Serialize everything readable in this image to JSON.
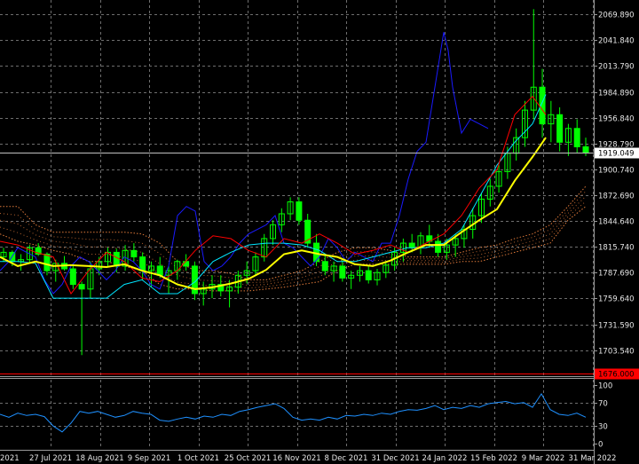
{
  "chart_data": {
    "type": "candlestick",
    "grid": true,
    "colors": {
      "background": "#000000",
      "grid": "#6e6e6e",
      "axis_text": "#e6e6e6",
      "candle": "#00ff00",
      "ma_long": "#ffff00",
      "tenkan": "#ff0000",
      "kijun": "#00e5ff",
      "chikou": "#1a1aff",
      "cloud": "#e07a3a",
      "rsi": "#1e90ff",
      "current_price_line": "#c0c0c0",
      "alert_line": "#ff0000",
      "alert_tag_bg": "#ff0000",
      "current_tag_bg": "#ffffff"
    },
    "price_axis": {
      "ylim": [
        1676.0,
        2085.0
      ],
      "ticks": [
        "2069.890",
        "2041.840",
        "2013.790",
        "1984.890",
        "1956.840",
        "1928.790",
        "1900.740",
        "1872.690",
        "1844.640",
        "1815.740",
        "1787.690",
        "1759.640",
        "1731.590",
        "1703.540"
      ]
    },
    "current_price": "1919.049",
    "alert_level": "1676.000",
    "date_axis": {
      "labels": [
        "2021",
        "27 Jul 2021",
        "18 Aug 2021",
        "9 Sep 2021",
        "1 Oct 2021",
        "25 Oct 2021",
        "16 Nov 2021",
        "8 Dec 2021",
        "31 Dec 2021",
        "24 Jan 2022",
        "15 Feb 2022",
        "9 Mar 2022",
        "31 Mar 2022"
      ]
    },
    "rsi_axis": {
      "ylim": [
        0,
        100
      ],
      "ticks": [
        "100",
        "70",
        "30",
        "0"
      ]
    },
    "series": [
      {
        "key": "ma_long",
        "x": [
          0,
          20,
          40,
          60,
          80,
          100,
          120,
          140,
          160,
          180,
          200,
          220,
          240,
          260,
          280,
          300,
          320,
          340,
          360,
          380,
          400,
          420,
          440,
          460,
          480,
          500,
          520,
          540,
          560,
          580,
          600,
          615
        ],
        "values": [
          1805,
          1795,
          1800,
          1795,
          1796,
          1795,
          1794,
          1797,
          1790,
          1785,
          1775,
          1770,
          1772,
          1776,
          1781,
          1791,
          1808,
          1812,
          1808,
          1805,
          1797,
          1795,
          1801,
          1810,
          1818,
          1818,
          1832,
          1845,
          1857,
          1888,
          1914,
          1935
        ]
      },
      {
        "key": "tenkan",
        "x": [
          0,
          20,
          40,
          60,
          80,
          100,
          120,
          140,
          160,
          180,
          200,
          220,
          240,
          260,
          280,
          300,
          320,
          340,
          360,
          380,
          400,
          420,
          440,
          460,
          480,
          500,
          520,
          540,
          560,
          580,
          600,
          615
        ],
        "values": [
          1822,
          1818,
          1810,
          1805,
          1765,
          1790,
          1810,
          1800,
          1782,
          1778,
          1790,
          1812,
          1828,
          1825,
          1812,
          1805,
          1825,
          1820,
          1830,
          1820,
          1808,
          1812,
          1818,
          1810,
          1820,
          1830,
          1850,
          1880,
          1900,
          1960,
          1980,
          1960
        ]
      },
      {
        "key": "kijun",
        "x": [
          0,
          20,
          40,
          60,
          80,
          100,
          120,
          140,
          160,
          180,
          200,
          220,
          240,
          260,
          280,
          300,
          320,
          340,
          360,
          380,
          400,
          420,
          440,
          460,
          480,
          500,
          520,
          540,
          560,
          580,
          600,
          615
        ],
        "values": [
          1800,
          1800,
          1798,
          1760,
          1760,
          1760,
          1760,
          1775,
          1780,
          1765,
          1765,
          1778,
          1800,
          1810,
          1818,
          1820,
          1820,
          1818,
          1812,
          1800,
          1800,
          1805,
          1810,
          1815,
          1815,
          1820,
          1835,
          1870,
          1905,
          1930,
          1950,
          1982
        ]
      },
      {
        "key": "chikou",
        "x": [
          0,
          10,
          20,
          30,
          40,
          50,
          60,
          70,
          80,
          90,
          100,
          110,
          120,
          130,
          140,
          150,
          160,
          170,
          180,
          190,
          200,
          210,
          220,
          230,
          240,
          250,
          260,
          270,
          280,
          290,
          300,
          310,
          320,
          330,
          340,
          350,
          360,
          370,
          380,
          390,
          400,
          410,
          420,
          430,
          440,
          450,
          460,
          470,
          480,
          490,
          500,
          505,
          510,
          520,
          530,
          540,
          550
        ],
        "values": [
          1790,
          1800,
          1815,
          1810,
          1805,
          1780,
          1765,
          1775,
          1795,
          1805,
          1800,
          1790,
          1780,
          1790,
          1805,
          1800,
          1790,
          1775,
          1770,
          1795,
          1850,
          1860,
          1855,
          1800,
          1790,
          1795,
          1805,
          1820,
          1830,
          1835,
          1840,
          1850,
          1820,
          1815,
          1805,
          1795,
          1805,
          1825,
          1815,
          1800,
          1810,
          1805,
          1800,
          1820,
          1820,
          1850,
          1890,
          1920,
          1930,
          1990,
          2050,
          2030,
          1990,
          1940,
          1955,
          1950,
          1945
        ]
      },
      {
        "key": "cloud_a",
        "x": [
          0,
          20,
          40,
          60,
          80,
          100,
          120,
          140,
          160,
          180,
          200,
          220,
          240,
          260,
          280,
          300,
          320,
          340,
          360,
          380,
          400,
          420,
          440,
          460,
          480,
          500,
          520,
          540,
          560,
          580,
          600,
          620,
          640,
          660
        ],
        "values": [
          1860,
          1860,
          1840,
          1832,
          1832,
          1832,
          1832,
          1832,
          1830,
          1820,
          1800,
          1790,
          1790,
          1787,
          1780,
          1780,
          1785,
          1790,
          1800,
          1810,
          1815,
          1815,
          1812,
          1805,
          1805,
          1805,
          1810,
          1815,
          1818,
          1825,
          1830,
          1840,
          1860,
          1882
        ]
      },
      {
        "key": "cloud_b",
        "x": [
          0,
          20,
          40,
          60,
          80,
          100,
          120,
          140,
          160,
          180,
          200,
          220,
          240,
          260,
          280,
          300,
          320,
          340,
          360,
          380,
          400,
          420,
          440,
          460,
          480,
          500,
          520,
          540,
          560,
          580,
          600,
          620,
          640,
          660
        ],
        "values": [
          1830,
          1822,
          1818,
          1812,
          1808,
          1800,
          1800,
          1795,
          1790,
          1775,
          1770,
          1770,
          1768,
          1768,
          1768,
          1770,
          1772,
          1775,
          1778,
          1790,
          1797,
          1797,
          1797,
          1797,
          1797,
          1797,
          1800,
          1800,
          1805,
          1810,
          1815,
          1820,
          1845,
          1860
        ]
      },
      {
        "key": "rsi",
        "x": [
          0,
          10,
          20,
          30,
          40,
          50,
          60,
          70,
          80,
          90,
          100,
          110,
          120,
          130,
          140,
          150,
          160,
          170,
          180,
          190,
          200,
          210,
          220,
          230,
          240,
          250,
          260,
          270,
          280,
          290,
          300,
          310,
          320,
          330,
          340,
          350,
          360,
          370,
          380,
          390,
          400,
          410,
          420,
          430,
          440,
          450,
          460,
          470,
          480,
          490,
          500,
          510,
          520,
          530,
          540,
          550,
          560,
          570,
          580,
          590,
          600,
          610,
          620,
          630,
          640,
          650,
          660
        ],
        "values": [
          50,
          45,
          52,
          48,
          50,
          46,
          30,
          20,
          35,
          55,
          52,
          55,
          50,
          45,
          48,
          55,
          52,
          50,
          40,
          38,
          42,
          45,
          42,
          47,
          45,
          50,
          48,
          55,
          58,
          62,
          65,
          68,
          60,
          45,
          40,
          42,
          40,
          45,
          42,
          48,
          47,
          50,
          48,
          52,
          50,
          55,
          58,
          57,
          60,
          65,
          58,
          62,
          60,
          65,
          62,
          68,
          70,
          72,
          68,
          70,
          62,
          85,
          58,
          50,
          48,
          52,
          45
        ]
      }
    ],
    "candles": {
      "note": "OHLC in price units, ordered by date",
      "ohlc": [
        [
          1805,
          1815,
          1800,
          1810
        ],
        [
          1810,
          1812,
          1795,
          1800
        ],
        [
          1800,
          1808,
          1790,
          1802
        ],
        [
          1802,
          1818,
          1798,
          1815
        ],
        [
          1815,
          1820,
          1806,
          1808
        ],
        [
          1808,
          1810,
          1785,
          1790
        ],
        [
          1790,
          1802,
          1778,
          1798
        ],
        [
          1798,
          1806,
          1790,
          1792
        ],
        [
          1792,
          1798,
          1770,
          1775
        ],
        [
          1775,
          1778,
          1698,
          1770
        ],
        [
          1770,
          1800,
          1760,
          1792
        ],
        [
          1792,
          1805,
          1785,
          1800
        ],
        [
          1800,
          1815,
          1795,
          1810
        ],
        [
          1810,
          1814,
          1788,
          1795
        ],
        [
          1795,
          1818,
          1790,
          1812
        ],
        [
          1812,
          1820,
          1800,
          1805
        ],
        [
          1805,
          1810,
          1780,
          1790
        ],
        [
          1790,
          1800,
          1772,
          1795
        ],
        [
          1795,
          1805,
          1782,
          1785
        ],
        [
          1785,
          1795,
          1765,
          1790
        ],
        [
          1790,
          1802,
          1780,
          1800
        ],
        [
          1800,
          1808,
          1790,
          1795
        ],
        [
          1795,
          1800,
          1758,
          1765
        ],
        [
          1765,
          1778,
          1752,
          1770
        ],
        [
          1770,
          1785,
          1760,
          1775
        ],
        [
          1775,
          1785,
          1762,
          1768
        ],
        [
          1768,
          1780,
          1750,
          1772
        ],
        [
          1772,
          1790,
          1765,
          1785
        ],
        [
          1785,
          1800,
          1776,
          1790
        ],
        [
          1790,
          1810,
          1785,
          1805
        ],
        [
          1805,
          1830,
          1800,
          1825
        ],
        [
          1825,
          1845,
          1818,
          1840
        ],
        [
          1840,
          1858,
          1832,
          1852
        ],
        [
          1852,
          1870,
          1845,
          1865
        ],
        [
          1865,
          1870,
          1840,
          1845
        ],
        [
          1845,
          1852,
          1815,
          1820
        ],
        [
          1820,
          1830,
          1795,
          1800
        ],
        [
          1800,
          1808,
          1785,
          1790
        ],
        [
          1790,
          1800,
          1778,
          1795
        ],
        [
          1795,
          1802,
          1778,
          1782
        ],
        [
          1782,
          1790,
          1770,
          1785
        ],
        [
          1785,
          1795,
          1778,
          1790
        ],
        [
          1790,
          1796,
          1776,
          1780
        ],
        [
          1780,
          1792,
          1774,
          1788
        ],
        [
          1788,
          1800,
          1782,
          1796
        ],
        [
          1796,
          1815,
          1790,
          1810
        ],
        [
          1810,
          1825,
          1800,
          1820
        ],
        [
          1820,
          1830,
          1810,
          1815
        ],
        [
          1815,
          1832,
          1808,
          1828
        ],
        [
          1828,
          1840,
          1815,
          1822
        ],
        [
          1822,
          1830,
          1805,
          1810
        ],
        [
          1810,
          1825,
          1802,
          1818
        ],
        [
          1818,
          1830,
          1805,
          1825
        ],
        [
          1825,
          1840,
          1815,
          1835
        ],
        [
          1835,
          1858,
          1825,
          1850
        ],
        [
          1850,
          1875,
          1842,
          1868
        ],
        [
          1868,
          1890,
          1860,
          1882
        ],
        [
          1882,
          1905,
          1875,
          1898
        ],
        [
          1898,
          1925,
          1890,
          1918
        ],
        [
          1918,
          1945,
          1910,
          1935
        ],
        [
          1935,
          1975,
          1925,
          1965
        ],
        [
          1965,
          2075,
          1955,
          1990
        ],
        [
          1990,
          2010,
          1935,
          1950
        ],
        [
          1950,
          1975,
          1930,
          1960
        ],
        [
          1960,
          1968,
          1920,
          1930
        ],
        [
          1930,
          1950,
          1915,
          1945
        ],
        [
          1945,
          1955,
          1918,
          1925
        ],
        [
          1925,
          1935,
          1915,
          1919
        ]
      ]
    }
  }
}
